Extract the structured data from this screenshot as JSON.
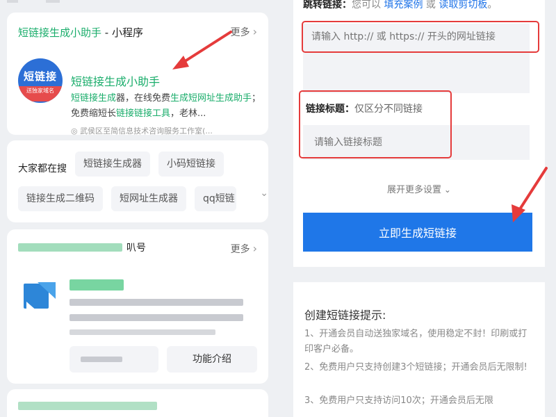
{
  "left": {
    "miniapp_card": {
      "header_highlight": "短链接生成小助手",
      "header_suffix": " - 小程序",
      "more_label": "更多",
      "logo_text": "短链接",
      "logo_sub": "送独家域名",
      "app_title": "短链接生成小助手",
      "desc_part1": "短链接生成",
      "desc_part2": "器，在线免费",
      "desc_part3": "生成短网址生成助手",
      "desc_part4": "；免费缩短长",
      "desc_part5": "链接链接工具",
      "desc_part6": "，老林...",
      "company": "◎ 武侯区至简信息技术咨询服务工作室(..."
    },
    "search_card": {
      "label": "大家都在搜",
      "chips": [
        "短链接生成器",
        "小码短链接",
        "链接生成二维码",
        "短网址生成器",
        "qq短链"
      ]
    },
    "account_card": {
      "header_suffix": "叭号",
      "more_label": "更多",
      "func_label": "功能介绍"
    }
  },
  "right": {
    "jump_label": "跳转链接：",
    "jump_hint": "您可以",
    "fill_example": "填充案例",
    "or_text": "或",
    "read_clipboard": "读取剪切板",
    "period": "。",
    "url_placeholder": "请输入 http:// 或 https:// 开头的网址链接",
    "title_label": "链接标题：",
    "title_hint": "仅区分不同链接",
    "title_placeholder": "请输入链接标题",
    "expand_label": "展开更多设置",
    "generate_button": "立即生成短链接",
    "tips_title": "创建短链接提示:",
    "tips": [
      "1、开通会员自动送独家域名，使用稳定不封！印刷或打印客户必备。",
      "2、免费用户只支持创建3个短链接；开通会员后无限制!",
      "3、免费用户只支持访问10次；开通会员后无限"
    ]
  },
  "colors": {
    "accent_green": "#1aad6b",
    "link_blue": "#1e73e8",
    "button_blue": "#1f77e8",
    "highlight_red": "#e53b3b"
  }
}
